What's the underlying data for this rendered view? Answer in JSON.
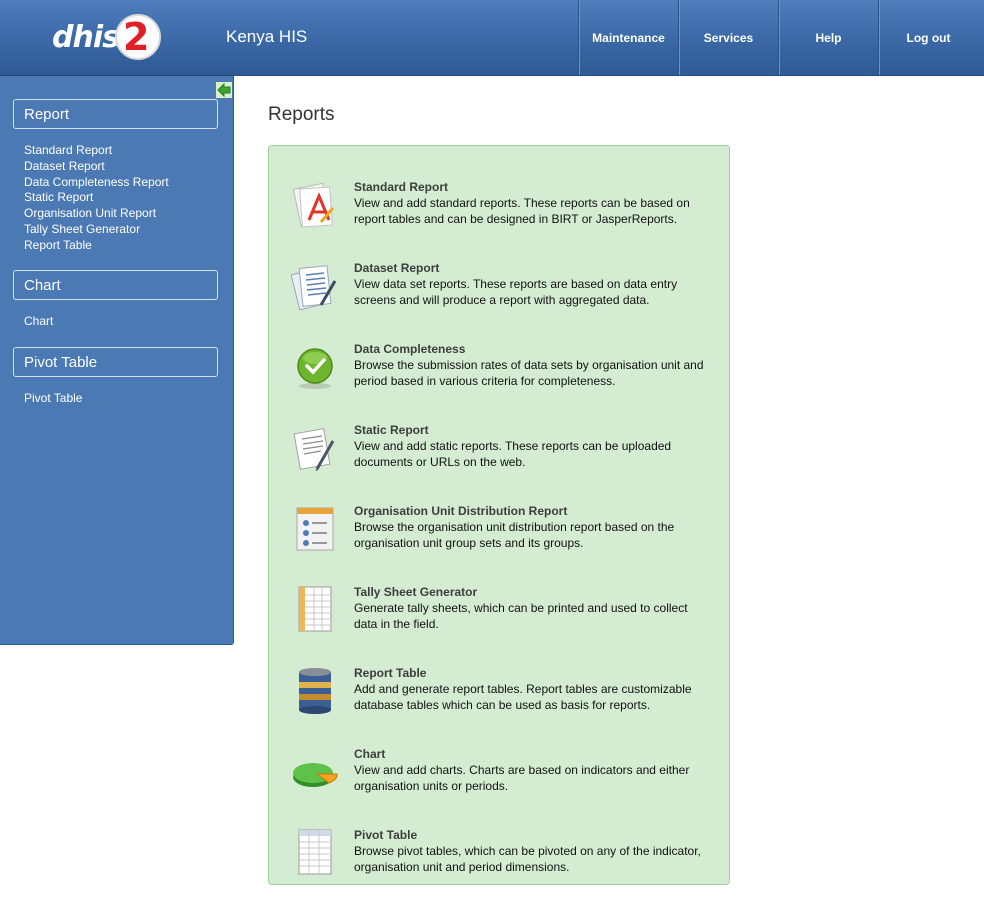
{
  "header": {
    "logo_text": "dhis",
    "logo_number": "2",
    "app_title": "Kenya HIS",
    "nav": [
      "Maintenance",
      "Services",
      "Help",
      "Log out"
    ]
  },
  "sidebar": {
    "sections": [
      {
        "title": "Report",
        "links": [
          "Standard Report",
          "Dataset Report",
          "Data Completeness Report",
          "Static Report",
          "Organisation Unit Report",
          "Tally Sheet Generator",
          "Report Table"
        ]
      },
      {
        "title": "Chart",
        "links": [
          "Chart"
        ]
      },
      {
        "title": "Pivot Table",
        "links": [
          "Pivot Table"
        ]
      }
    ]
  },
  "main": {
    "title": "Reports",
    "entries": [
      {
        "title": "Standard Report",
        "icon": "standard-report-icon",
        "desc": "View and add standard reports. These reports can be based on report tables and can be designed in BIRT or JasperReports."
      },
      {
        "title": "Dataset Report",
        "icon": "dataset-report-icon",
        "desc": "View data set reports. These reports are based on data entry screens and will produce a report with aggregated data."
      },
      {
        "title": "Data Completeness",
        "icon": "check-icon",
        "desc": "Browse the submission rates of data sets by organisation unit and period based in various criteria for completeness."
      },
      {
        "title": "Static Report",
        "icon": "static-report-icon",
        "desc": "View and add static reports. These reports can be uploaded documents or URLs on the web."
      },
      {
        "title": "Organisation Unit Distribution Report",
        "icon": "org-unit-report-icon",
        "desc": "Browse the organisation unit distribution report based on the organisation unit group sets and its groups."
      },
      {
        "title": "Tally Sheet Generator",
        "icon": "tally-sheet-icon",
        "desc": "Generate tally sheets, which can be printed and used to collect data in the field."
      },
      {
        "title": "Report Table",
        "icon": "database-icon",
        "desc": "Add and generate report tables. Report tables are customizable database tables which can be used as basis for reports."
      },
      {
        "title": "Chart",
        "icon": "pie-chart-icon",
        "desc": "View and add charts. Charts are based on indicators and either organisation units or periods."
      },
      {
        "title": "Pivot Table",
        "icon": "pivot-table-icon",
        "desc": "Browse pivot tables, which can be pivoted on any of the indicator, organisation unit and period dimensions."
      }
    ]
  }
}
